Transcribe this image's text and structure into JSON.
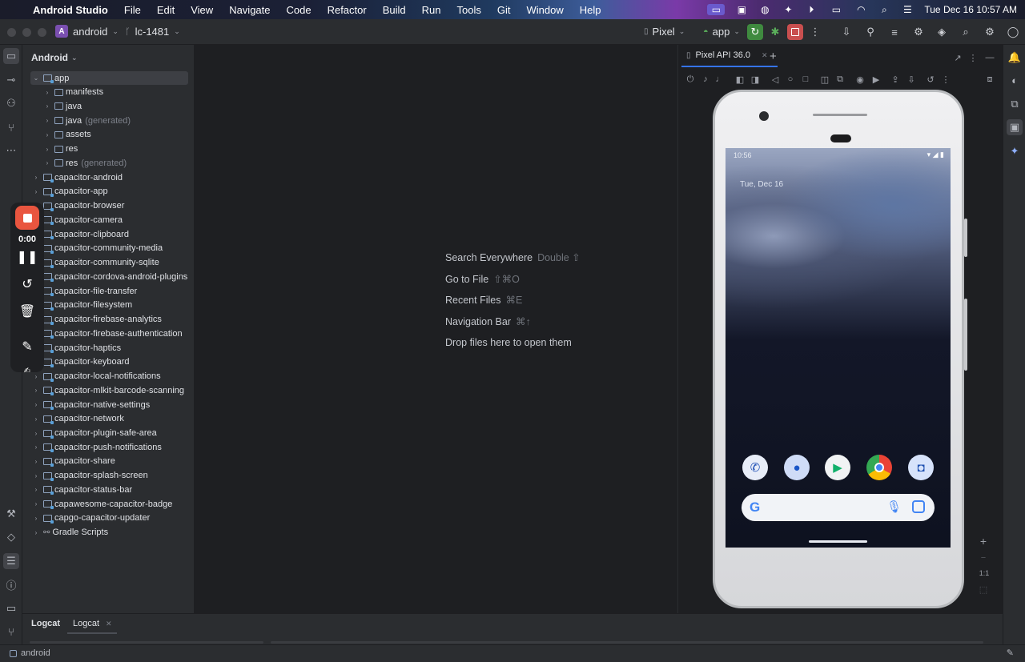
{
  "menubar": {
    "apple": "",
    "items": [
      "Android Studio",
      "File",
      "Edit",
      "View",
      "Navigate",
      "Code",
      "Refactor",
      "Build",
      "Run",
      "Tools",
      "Git",
      "Window",
      "Help"
    ],
    "clock": "Tue Dec 16  10:57 AM"
  },
  "toolbar": {
    "project_badge": "A",
    "project_name": "android",
    "branch": "lc-1481",
    "device": "Pixel",
    "run_config": "app"
  },
  "project_panel": {
    "title": "Android",
    "tree": [
      {
        "label": "app",
        "hint": "",
        "expanded": true,
        "level": 0,
        "selected": true
      },
      {
        "label": "manifests",
        "hint": "",
        "level": 1
      },
      {
        "label": "java",
        "hint": "",
        "level": 1
      },
      {
        "label": "java",
        "hint": "(generated)",
        "level": 1
      },
      {
        "label": "assets",
        "hint": "",
        "level": 1
      },
      {
        "label": "res",
        "hint": "",
        "level": 1
      },
      {
        "label": "res",
        "hint": "(generated)",
        "level": 1
      },
      {
        "label": "capacitor-android",
        "hint": "",
        "level": 0
      },
      {
        "label": "capacitor-app",
        "hint": "",
        "level": 0
      },
      {
        "label": "capacitor-browser",
        "hint": "",
        "level": 0
      },
      {
        "label": "capacitor-camera",
        "hint": "",
        "level": 0
      },
      {
        "label": "capacitor-clipboard",
        "hint": "",
        "level": 0
      },
      {
        "label": "capacitor-community-media",
        "hint": "",
        "level": 0
      },
      {
        "label": "capacitor-community-sqlite",
        "hint": "",
        "level": 0
      },
      {
        "label": "capacitor-cordova-android-plugins",
        "hint": "",
        "level": 0
      },
      {
        "label": "capacitor-file-transfer",
        "hint": "",
        "level": 0
      },
      {
        "label": "capacitor-filesystem",
        "hint": "",
        "level": 0
      },
      {
        "label": "capacitor-firebase-analytics",
        "hint": "",
        "level": 0
      },
      {
        "label": "capacitor-firebase-authentication",
        "hint": "",
        "level": 0
      },
      {
        "label": "capacitor-haptics",
        "hint": "",
        "level": 0
      },
      {
        "label": "capacitor-keyboard",
        "hint": "",
        "level": 0
      },
      {
        "label": "capacitor-local-notifications",
        "hint": "",
        "level": 0
      },
      {
        "label": "capacitor-mlkit-barcode-scanning",
        "hint": "",
        "level": 0
      },
      {
        "label": "capacitor-native-settings",
        "hint": "",
        "level": 0
      },
      {
        "label": "capacitor-network",
        "hint": "",
        "level": 0
      },
      {
        "label": "capacitor-plugin-safe-area",
        "hint": "",
        "level": 0
      },
      {
        "label": "capacitor-push-notifications",
        "hint": "",
        "level": 0
      },
      {
        "label": "capacitor-share",
        "hint": "",
        "level": 0
      },
      {
        "label": "capacitor-splash-screen",
        "hint": "",
        "level": 0
      },
      {
        "label": "capacitor-status-bar",
        "hint": "",
        "level": 0
      },
      {
        "label": "capawesome-capacitor-badge",
        "hint": "",
        "level": 0
      },
      {
        "label": "capgo-capacitor-updater",
        "hint": "",
        "level": 0
      },
      {
        "label": "Gradle Scripts",
        "hint": "",
        "level": 0,
        "gradle": true
      }
    ]
  },
  "recording": {
    "time": "0:00"
  },
  "editor": {
    "hints": [
      {
        "label": "Search Everywhere",
        "key": "Double ⇧"
      },
      {
        "label": "Go to File",
        "key": "⇧⌘O"
      },
      {
        "label": "Recent Files",
        "key": "⌘E"
      },
      {
        "label": "Navigation Bar",
        "key": "⌘↑"
      },
      {
        "label": "Drop files here to open them",
        "key": ""
      }
    ]
  },
  "emulator": {
    "tab_label": "Pixel API 36.0",
    "status_time": "10:56",
    "lock_date": "Tue, Dec 16",
    "zoom_label": "1:1"
  },
  "bottom": {
    "tool_title": "Logcat",
    "tab_label": "Logcat"
  },
  "statusbar": {
    "crumb": "android"
  },
  "colors": {
    "accent": "#3574f0",
    "record_red": "#e9553f",
    "run_green": "#3f8a3f",
    "stop_red": "#c94f4f"
  }
}
